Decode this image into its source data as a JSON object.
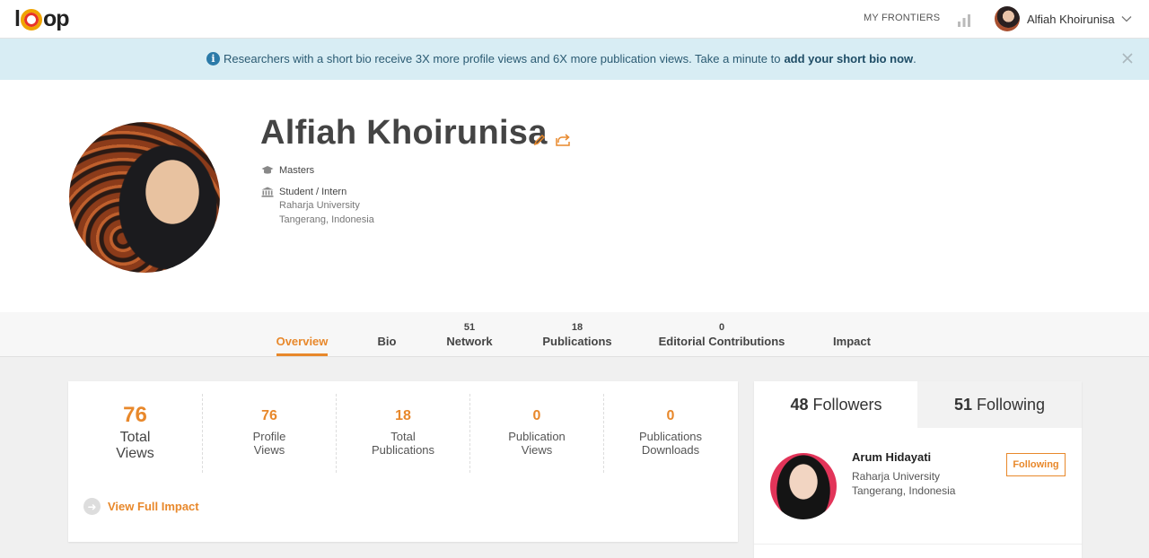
{
  "topbar": {
    "logo_start": "l",
    "logo_end": "op",
    "nav_label": "MY FRONTIERS",
    "user_name": "Alfiah Khoirunisa"
  },
  "banner": {
    "text": "Researchers with a short bio receive 3X more profile views and 6X more publication views. Take a minute to",
    "link": "add your short bio now",
    "suffix": "."
  },
  "profile": {
    "name": "Alfiah Khoirunisa",
    "degree": "Masters",
    "position": "Student / Intern",
    "institution": "Raharja University",
    "location": "Tangerang, Indonesia"
  },
  "tabs": [
    {
      "count": "",
      "label": "Overview"
    },
    {
      "count": "",
      "label": "Bio"
    },
    {
      "count": "51",
      "label": "Network"
    },
    {
      "count": "18",
      "label": "Publications"
    },
    {
      "count": "0",
      "label": "Editorial Contributions"
    },
    {
      "count": "",
      "label": "Impact"
    }
  ],
  "stats": [
    {
      "value": "76",
      "label1": "Total",
      "label2": "Views"
    },
    {
      "value": "76",
      "label1": "Profile",
      "label2": "Views"
    },
    {
      "value": "18",
      "label1": "Total",
      "label2": "Publications"
    },
    {
      "value": "0",
      "label1": "Publication",
      "label2": "Views"
    },
    {
      "value": "0",
      "label1": "Publications",
      "label2": "Downloads"
    }
  ],
  "view_impact": "View Full Impact",
  "follow": {
    "followers_count": "48",
    "followers_label": "Followers",
    "following_count": "51",
    "following_label": "Following",
    "person": {
      "name": "Arum Hidayati",
      "institution": "Raharja University",
      "location": "Tangerang, Indonesia",
      "button": "Following"
    }
  },
  "colors": {
    "accent": "#e8882b",
    "banner_bg": "#d8edf4",
    "banner_text": "#2b5b73"
  }
}
